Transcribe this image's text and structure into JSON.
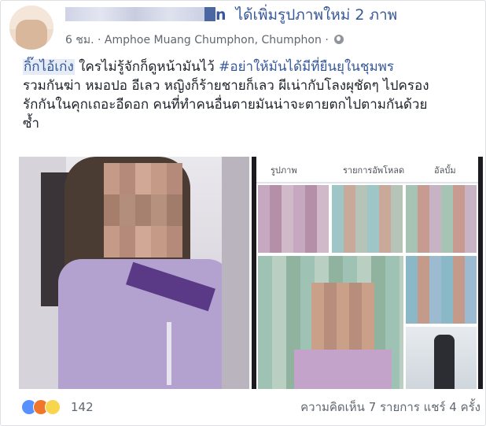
{
  "post": {
    "author_suffix": "n",
    "action": "ได้เพิ่มรูปภาพใหม่ 2 ภาพ",
    "time": "6 ชม.",
    "separator": "·",
    "location": "Amphoe Muang Chumphon, Chumphon",
    "separator2": "·",
    "privacy_icon": "globe-icon",
    "text_highlight": "กิ๊กไอ้เก่ง",
    "text_line1_rest": " ใครไม่รู้จักก็ดูหน้ามันไว้ ",
    "hashtag": "#อย่าให้มันได้มีที่ยืนยุในชุมพร",
    "text_line2": "รวมกันฆ่า หมอปอ อีเลว หญิงก็ร้ายชายก็เลว ผีเน่ากับโลงผุชัดๆ ไปครอง",
    "text_line3": "รักกันในคุกเถอะอีดอก คนที่ทำคนอื่นตายมันน่าจะตายตกไปตามกันด้วย",
    "text_line4": "ซ้ำ"
  },
  "screenshot_tabs": [
    "รูปภาพ",
    "รายการอัพโหลด",
    "อัลบั้ม"
  ],
  "footer": {
    "reaction_icons": [
      "like-icon",
      "angry-icon",
      "sad-icon"
    ],
    "reaction_count": "142",
    "comments_shares": "ความคิดเห็น 7 รายการ  แชร์ 4 ครั้ง"
  },
  "colors": {
    "link": "#365899",
    "meta": "#606770",
    "highlight_bg": "#e6ecf6"
  }
}
